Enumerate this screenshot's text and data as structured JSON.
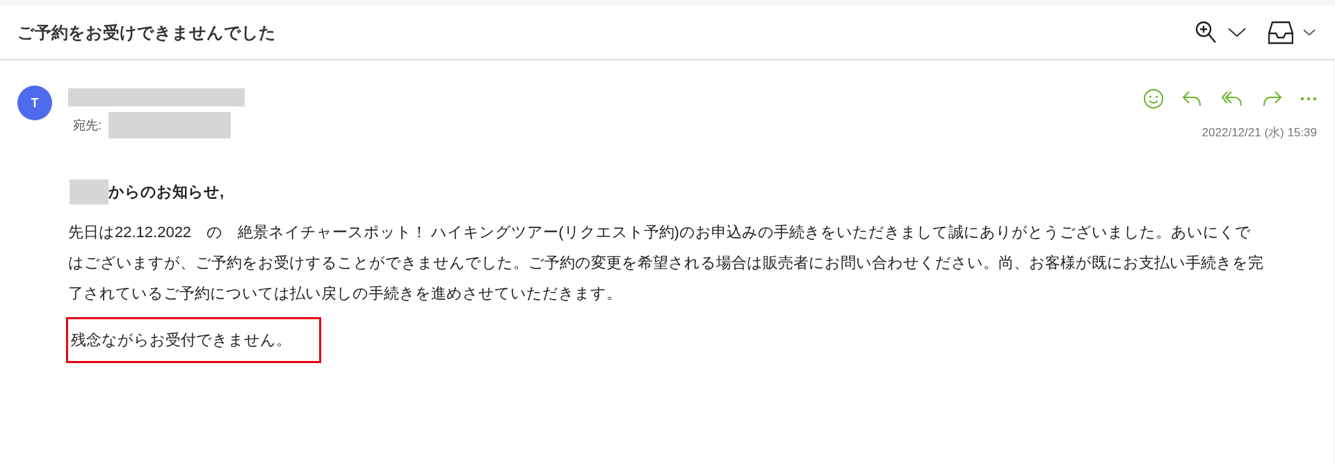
{
  "subject": "ご予約をお受けできませんでした",
  "message": {
    "avatar_initial": "T",
    "recipient_label": "宛先:",
    "date": "2022/12/21 (水) 15:39",
    "greeting": "からのお知らせ,",
    "body": "先日は22.12.2022　の　絶景ネイチャースポット！ ハイキングツアー(リクエスト予約)のお申込みの手続きをいただきまして誠にありがとうございました。あいにくではございますが、ご予約をお受けすることができませんでした。ご予約の変更を希望される場合は販売者にお問い合わせください。尚、お客様が既にお支払い手続きを完了されているご予約については払い戻しの手続きを進めさせていただきます。",
    "notice": {
      "text": "残念ながらお受付できません。",
      "highlighted": true
    }
  }
}
